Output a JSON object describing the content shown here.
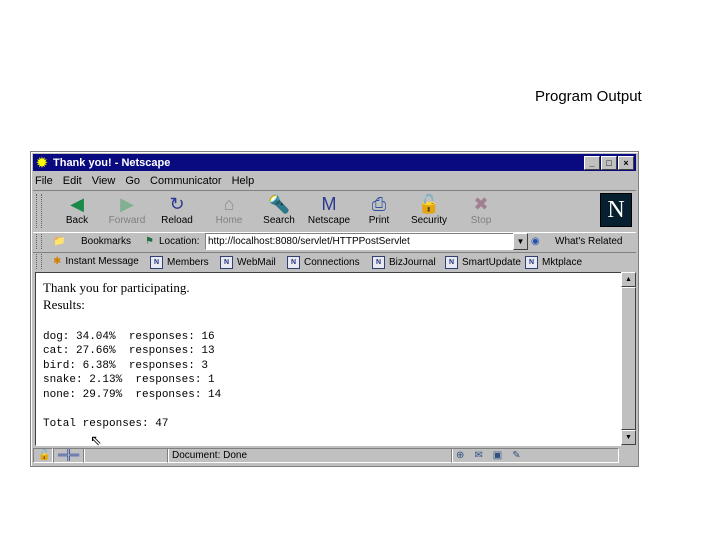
{
  "slide": {
    "title": "Program Output"
  },
  "window": {
    "title": "Thank you! - Netscape",
    "controls": {
      "minimize": "_",
      "maximize": "□",
      "close": "×"
    }
  },
  "menu": [
    "File",
    "Edit",
    "View",
    "Go",
    "Communicator",
    "Help"
  ],
  "nav_buttons": [
    {
      "label": "Back",
      "icon": "back-arrow-icon",
      "glyph": "◀",
      "enabled": true,
      "color": "#1a8a4a"
    },
    {
      "label": "Forward",
      "icon": "forward-arrow-icon",
      "glyph": "▶",
      "enabled": false,
      "color": "#80b090"
    },
    {
      "label": "Reload",
      "icon": "reload-icon",
      "glyph": "↻",
      "enabled": true,
      "color": "#2a3a90"
    },
    {
      "label": "Home",
      "icon": "home-icon",
      "glyph": "⌂",
      "enabled": false,
      "color": "#909090"
    },
    {
      "label": "Search",
      "icon": "search-icon",
      "glyph": "🔦",
      "enabled": true,
      "color": "#2a3a90"
    },
    {
      "label": "Netscape",
      "icon": "netscape-icon",
      "glyph": "M",
      "enabled": true,
      "color": "#2a3a90"
    },
    {
      "label": "Print",
      "icon": "print-icon",
      "glyph": "⎙",
      "enabled": true,
      "color": "#3050a0"
    },
    {
      "label": "Security",
      "icon": "security-lock-icon",
      "glyph": "🔓",
      "enabled": true,
      "color": "#804020"
    },
    {
      "label": "Stop",
      "icon": "stop-icon",
      "glyph": "✖",
      "enabled": false,
      "color": "#a08090"
    }
  ],
  "location_bar": {
    "bookmarks_label": "Bookmarks",
    "location_label": "Location:",
    "url": "http://localhost:8080/servlet/HTTPPostServlet",
    "related_label": "What's Related"
  },
  "personal_toolbar": [
    "Instant Message",
    "Members",
    "WebMail",
    "Connections",
    "BizJournal",
    "SmartUpdate",
    "Mktplace"
  ],
  "page": {
    "line1": "Thank you for participating.",
    "line2": "Results:",
    "results": [
      {
        "animal": "dog",
        "percent": "34.04%",
        "responses": 16
      },
      {
        "animal": "cat",
        "percent": "27.66%",
        "responses": 13
      },
      {
        "animal": "bird",
        "percent": "6.38%",
        "responses": 3
      },
      {
        "animal": "snake",
        "percent": "2.13%",
        "responses": 1
      },
      {
        "animal": "none",
        "percent": "29.79%",
        "responses": 14
      }
    ],
    "results_text": [
      "dog: 34.04%  responses: 16",
      "cat: 27.66%  responses: 13",
      "bird: 6.38%  responses: 3",
      "snake: 2.13%  responses: 1",
      "none: 29.79%  responses: 14"
    ],
    "total_text": "Total responses: 47"
  },
  "status": {
    "text": "Document: Done"
  }
}
